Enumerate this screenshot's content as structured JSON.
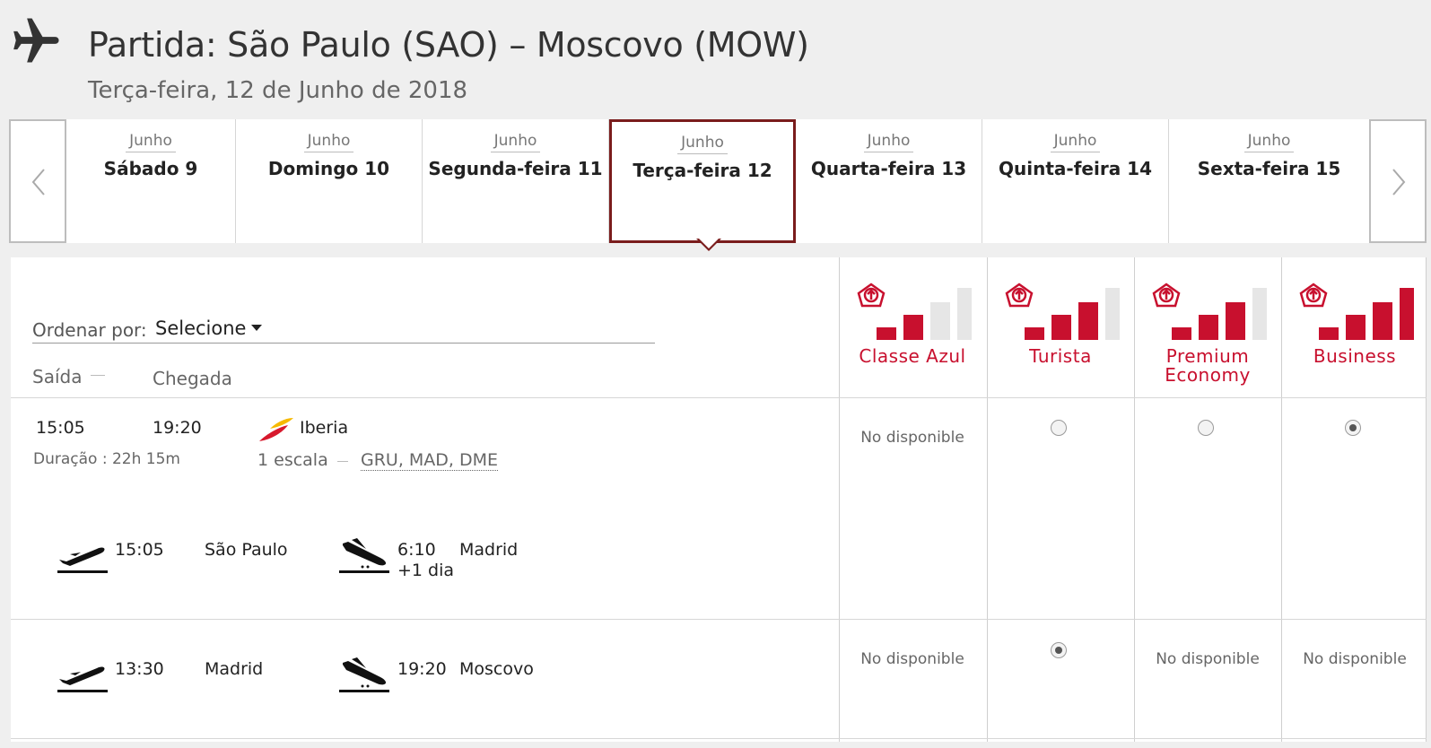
{
  "header": {
    "title": "Partida: São Paulo (SAO) – Moscovo (MOW)",
    "subtitle": "Terça-feira, 12 de Junho de 2018"
  },
  "date_strip": {
    "prev_icon": "chevron-left-icon",
    "next_icon": "chevron-right-icon",
    "days": [
      {
        "month": "Junho",
        "label": "Sábado 9"
      },
      {
        "month": "Junho",
        "label": "Domingo 10"
      },
      {
        "month": "Junho",
        "label": "Segunda-feira 11"
      },
      {
        "month": "Junho",
        "label": "Terça-feira 12",
        "selected": true
      },
      {
        "month": "Junho",
        "label": "Quarta-feira 13"
      },
      {
        "month": "Junho",
        "label": "Quinta-feira 14"
      },
      {
        "month": "Junho",
        "label": "Sexta-feira 15"
      }
    ]
  },
  "sort": {
    "label": "Ordenar por:",
    "value": "Selecione"
  },
  "columns": {
    "departure": "Saída",
    "arrival": "Chegada"
  },
  "classes": [
    {
      "name": "Classe Azul",
      "level": 2
    },
    {
      "name": "Turista",
      "level": 3
    },
    {
      "name": "Premium Economy",
      "level": 3
    },
    {
      "name": "Business",
      "level": 4
    }
  ],
  "colors": {
    "brand_red": "#c8102e",
    "selected_border": "#7a1c1c",
    "bar_inactive": "#e6e6e6"
  },
  "flight": {
    "departure": "15:05",
    "arrival": "19:20",
    "duration": "Duração : 22h 15m",
    "airline": "Iberia",
    "stops": "1 escala",
    "airports": "GRU, MAD, DME",
    "segments": [
      {
        "dep_time": "15:05",
        "dep_city": "São Paulo",
        "arr_time": "6:10",
        "arr_city": "Madrid",
        "arr_extra": "+1 dia",
        "availability": [
          "No disponible",
          "radio",
          "radio",
          "radio-checked"
        ]
      },
      {
        "dep_time": "13:30",
        "dep_city": "Madrid",
        "arr_time": "19:20",
        "arr_city": "Moscovo",
        "arr_extra": "",
        "availability": [
          "No disponible",
          "radio-checked",
          "No disponible",
          "No disponible"
        ]
      }
    ]
  }
}
